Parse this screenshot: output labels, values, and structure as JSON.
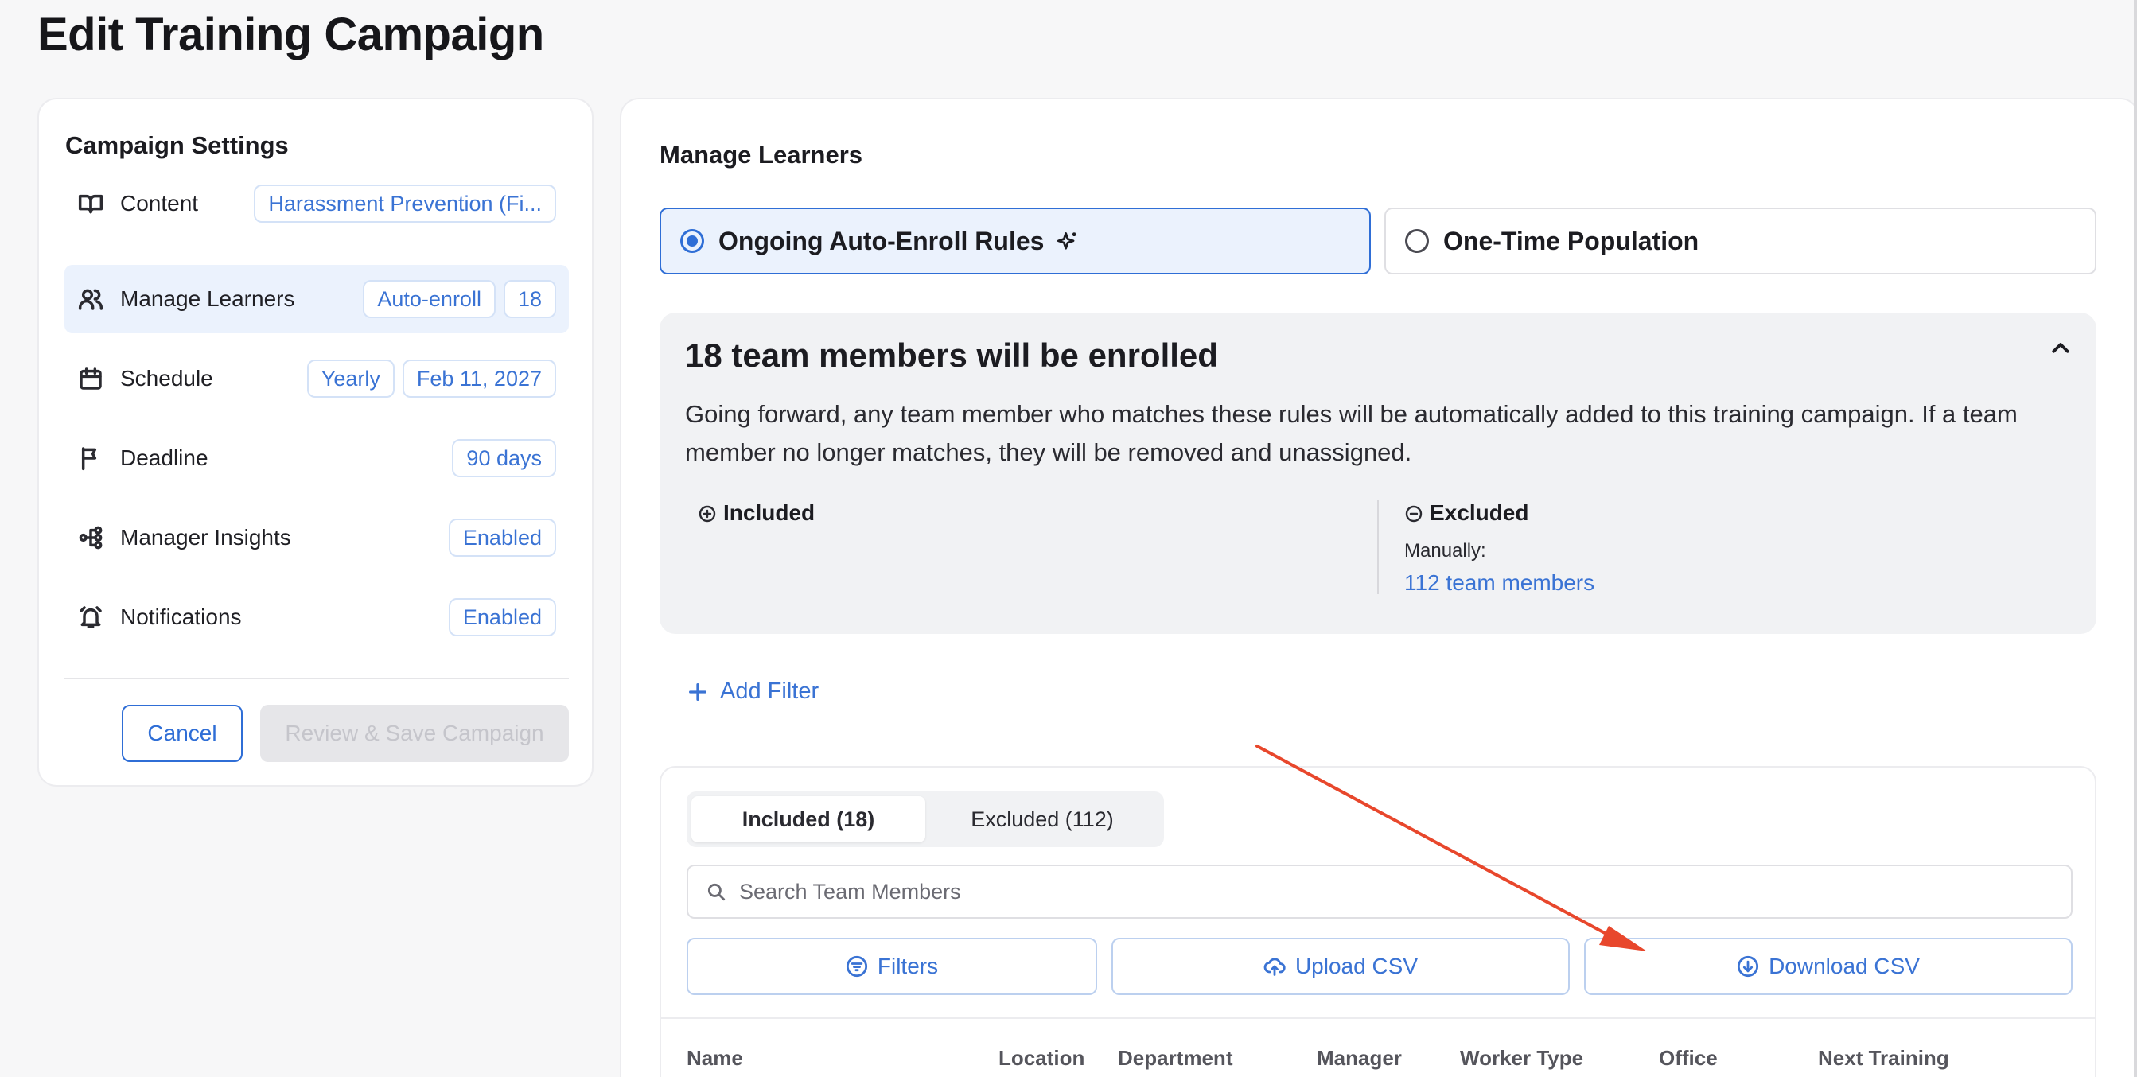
{
  "page": {
    "title": "Edit Training Campaign"
  },
  "settings": {
    "title": "Campaign Settings",
    "rows": [
      {
        "label": "Content",
        "icon": "book-icon",
        "chips": [
          "Harassment Prevention (Fi..."
        ]
      },
      {
        "label": "Manage Learners",
        "icon": "users-icon",
        "chips": [
          "Auto-enroll",
          "18"
        ],
        "active": true
      },
      {
        "label": "Schedule",
        "icon": "calendar-icon",
        "chips": [
          "Yearly",
          "Feb 11, 2027"
        ]
      },
      {
        "label": "Deadline",
        "icon": "flag-icon",
        "chips": [
          "90 days"
        ]
      },
      {
        "label": "Manager Insights",
        "icon": "hierarchy-icon",
        "chips": [
          "Enabled"
        ]
      },
      {
        "label": "Notifications",
        "icon": "alarm-bell-icon",
        "chips": [
          "Enabled"
        ]
      }
    ],
    "cancel_label": "Cancel",
    "review_label": "Review & Save Campaign"
  },
  "learners": {
    "title": "Manage Learners",
    "mode_auto": "Ongoing Auto-Enroll Rules",
    "mode_once": "One-Time Population",
    "summary": {
      "heading": "18 team members will be enrolled",
      "text": "Going forward, any team member who matches these rules will be automatically added to this training campaign. If a team member no longer matches, they will be removed and unassigned.",
      "included_label": "Included",
      "excluded_label": "Excluded",
      "manually_label": "Manually:",
      "excluded_link": "112 team members"
    },
    "add_filter_label": "Add Filter",
    "tabs": {
      "included": "Included (18)",
      "excluded": "Excluded (112)"
    },
    "search_placeholder": "Search Team Members",
    "filters_label": "Filters",
    "upload_label": "Upload CSV",
    "download_label": "Download CSV",
    "columns": [
      "Name",
      "Location",
      "Department",
      "Manager",
      "Worker Type",
      "Office",
      "Next Training"
    ]
  },
  "colors": {
    "accent": "#2f6ed6",
    "link": "#3a73d4",
    "annotation_arrow": "#e8472c",
    "active_bg": "#ebf2fd"
  }
}
